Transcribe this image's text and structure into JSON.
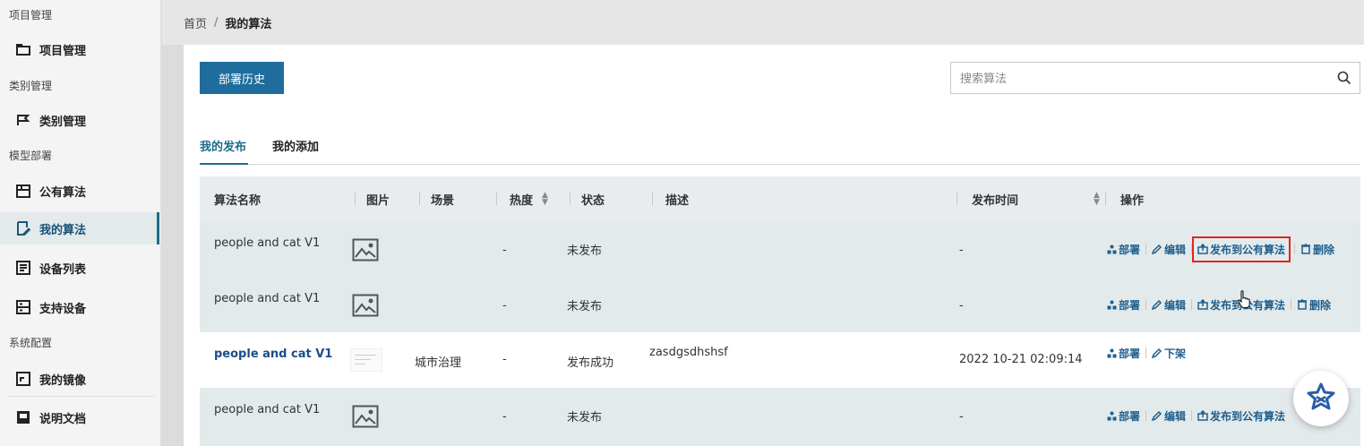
{
  "sidebar": {
    "groups": {
      "project": "项目管理",
      "category": "类别管理",
      "model": "模型部署",
      "system": "系统配置"
    },
    "items": [
      {
        "label": "项目管理",
        "icon": "folder-icon"
      },
      {
        "label": "类别管理",
        "icon": "flag-icon"
      },
      {
        "label": "公有算法",
        "icon": "image-frame-icon"
      },
      {
        "label": "我的算法",
        "icon": "edit-doc-icon",
        "active": true
      },
      {
        "label": "设备列表",
        "icon": "list-doc-icon"
      },
      {
        "label": "支持设备",
        "icon": "device-icon"
      },
      {
        "label": "我的镜像",
        "icon": "image-doc-icon"
      },
      {
        "label": "说明文档",
        "icon": "book-icon"
      }
    ]
  },
  "breadcrumb": {
    "home": "首页",
    "separator": "/",
    "current": "我的算法"
  },
  "toolbar": {
    "history_label": "部署历史"
  },
  "search": {
    "placeholder": "搜索算法",
    "value": ""
  },
  "tabs": [
    {
      "label": "我的发布",
      "active": true
    },
    {
      "label": "我的添加",
      "active": false
    }
  ],
  "table": {
    "columns": [
      "算法名称",
      "图片",
      "场景",
      "热度",
      "状态",
      "描述",
      "发布时间",
      "操作"
    ],
    "rows": [
      {
        "name": "people and cat V1",
        "image": "placeholder",
        "scene": "",
        "heat": "-",
        "status": "未发布",
        "description": "",
        "time": "-",
        "ops": [
          "部署",
          "编辑",
          "发布到公有算法",
          "删除"
        ]
      },
      {
        "name": "people and cat V1",
        "image": "placeholder",
        "scene": "",
        "heat": "-",
        "status": "未发布",
        "description": "",
        "time": "-",
        "ops": [
          "部署",
          "编辑",
          "发布到公有算法",
          "删除"
        ]
      },
      {
        "name": "people and cat V1",
        "image": "thumbnail",
        "scene": "城市治理",
        "heat": "-",
        "status": "发布成功",
        "description": "zasdgsdhshsf",
        "time": "2022 10-21 02:09:14",
        "ops": [
          "部署",
          "下架"
        ]
      },
      {
        "name": "people and cat V1",
        "image": "placeholder",
        "scene": "",
        "heat": "-",
        "status": "未发布",
        "description": "",
        "time": "-",
        "ops": [
          "部署",
          "编辑",
          "发布到公有算法"
        ]
      }
    ]
  },
  "colors": {
    "primary": "#1f6d9c",
    "link": "#1a4f8a",
    "highlight": "#e0261f",
    "row_alt": "#e3eaec"
  }
}
